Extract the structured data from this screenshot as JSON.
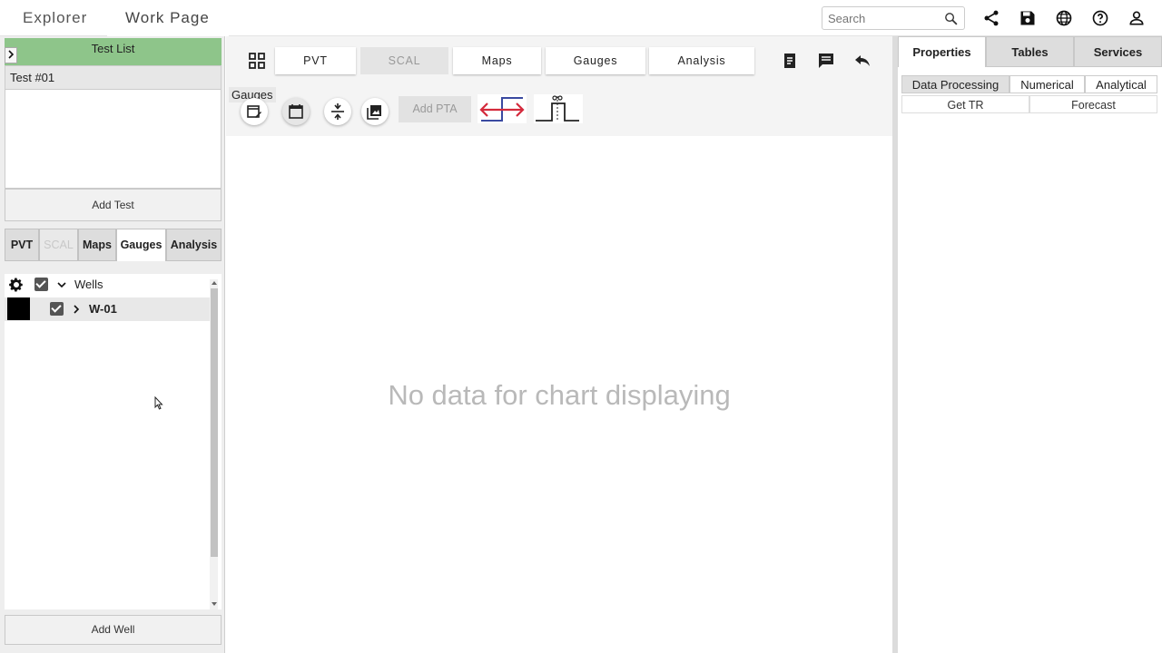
{
  "topbar": {
    "tabs": [
      "Explorer",
      "Work Page"
    ],
    "search_placeholder": "Search",
    "icons": [
      "share-icon",
      "save-icon",
      "globe-icon",
      "help-icon",
      "user-icon"
    ]
  },
  "left_panel": {
    "test_list_title": "Test List",
    "tests": [
      "Test #01"
    ],
    "add_test_label": "Add Test",
    "tabs": [
      "PVT",
      "SCAL",
      "Maps",
      "Gauges",
      "Analysis"
    ],
    "active_tab": "Gauges",
    "tree": {
      "root_label": "Wells",
      "wells": [
        "W-01"
      ]
    },
    "add_well_label": "Add Well"
  },
  "center": {
    "tabs": [
      "PVT",
      "SCAL",
      "Maps",
      "Gauges",
      "Analysis"
    ],
    "tooltip": "Gauges",
    "add_pta_label": "Add PTA",
    "empty_message": "No data for chart displaying"
  },
  "right_panel": {
    "tabs": [
      "Properties",
      "Tables",
      "Services"
    ],
    "subtabs": [
      "Data Processing",
      "Numerical",
      "Analytical"
    ],
    "actions": [
      "Get TR",
      "Forecast"
    ]
  },
  "colors": {
    "test_list_header": "#8ec58a",
    "arrow_red": "#d42a3c",
    "arrow_blue": "#3a4aa0"
  }
}
